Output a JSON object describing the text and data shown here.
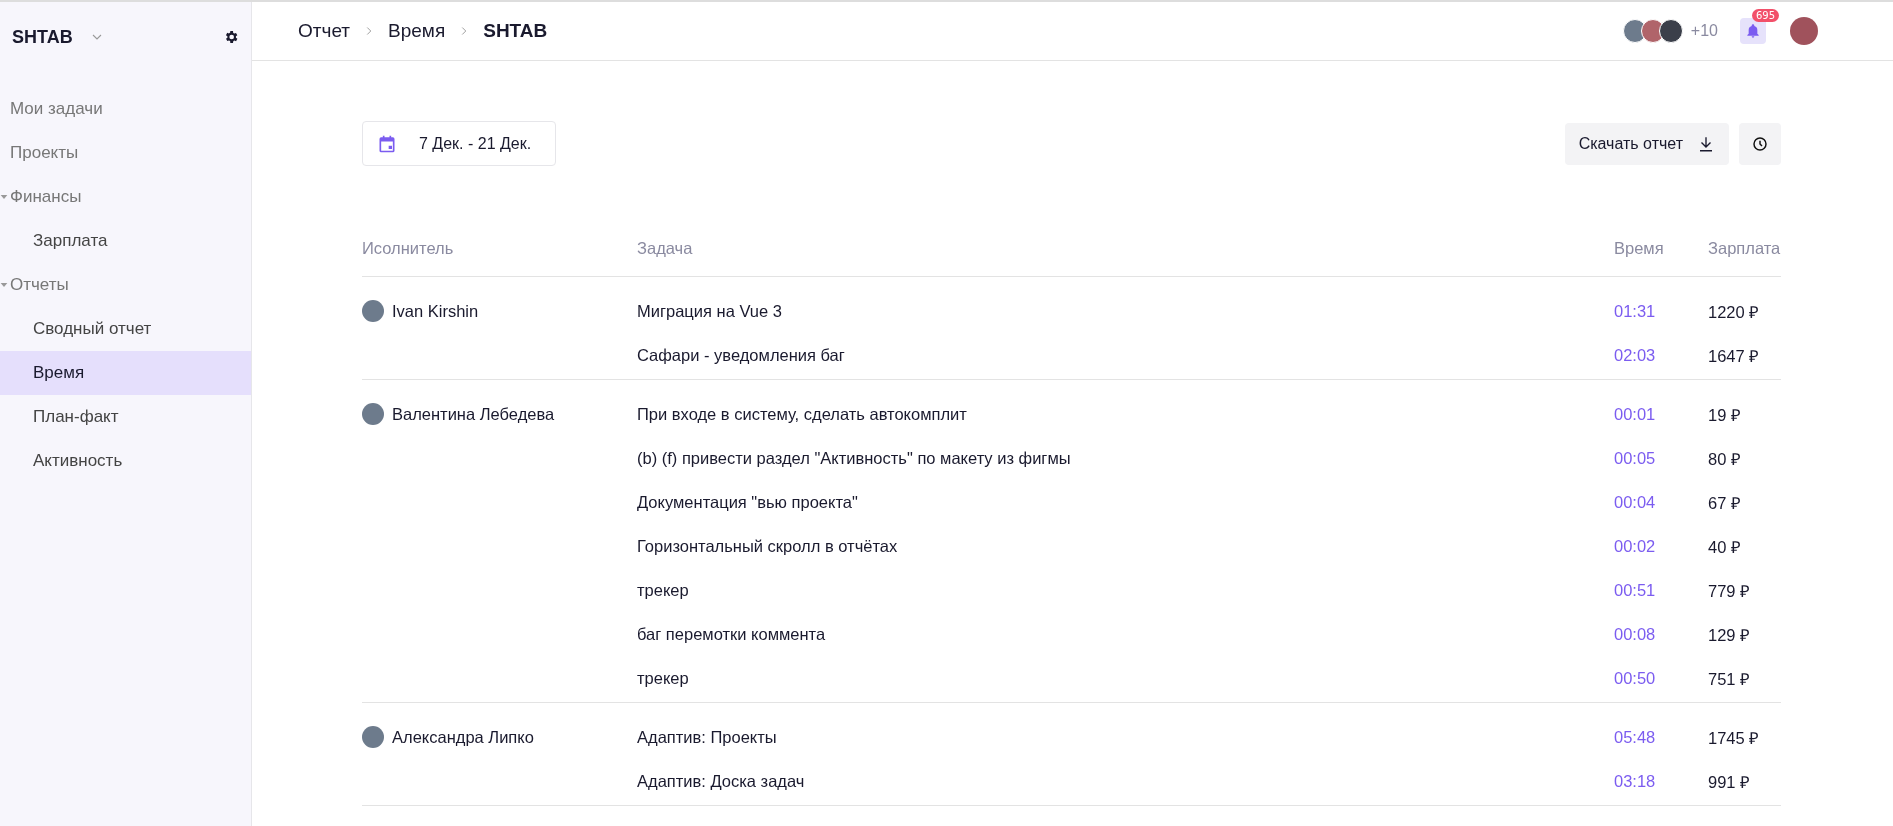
{
  "sidebar": {
    "workspace": "SHTAB",
    "items": [
      {
        "label": "Мои задачи",
        "selected": false
      },
      {
        "label": "Проекты",
        "selected": false
      },
      {
        "label": "Финансы",
        "selected": false,
        "expanded": true,
        "children": [
          {
            "label": "Зарплата",
            "selected": false
          }
        ]
      },
      {
        "label": "Отчеты",
        "selected": false,
        "expanded": true,
        "children": [
          {
            "label": "Сводный отчет",
            "selected": false
          },
          {
            "label": "Время",
            "selected": true
          },
          {
            "label": "План-факт",
            "selected": false
          },
          {
            "label": "Активность",
            "selected": false
          }
        ]
      }
    ]
  },
  "breadcrumbs": [
    "Отчет",
    "Время",
    "SHTAB"
  ],
  "header": {
    "more_members": "+10",
    "notifications": "695"
  },
  "date_range": "7 Дек. - 21 Дек.",
  "download_button": "Скачать отчет",
  "table": {
    "columns": [
      "Исолнитель",
      "Задача",
      "Время",
      "Зарплата"
    ],
    "groups": [
      {
        "executor": "Ivan Kirshin",
        "rows": [
          {
            "task": "Миграция на Vue 3",
            "time": "01:31",
            "salary": "1220 ₽"
          },
          {
            "task": "Сафари - уведомления баг",
            "time": "02:03",
            "salary": "1647 ₽"
          }
        ]
      },
      {
        "executor": "Валентина Лебедева",
        "rows": [
          {
            "task": "При входе в систему, сделать автокомплит",
            "time": "00:01",
            "salary": "19 ₽"
          },
          {
            "task": "(b) (f) привести раздел \"Активность\" по макету из фигмы",
            "time": "00:05",
            "salary": "80 ₽"
          },
          {
            "task": "Документация \"вью проекта\"",
            "time": "00:04",
            "salary": "67 ₽"
          },
          {
            "task": "Горизонтальный скролл в отчётах",
            "time": "00:02",
            "salary": "40 ₽"
          },
          {
            "task": "трекер",
            "time": "00:51",
            "salary": "779 ₽"
          },
          {
            "task": "баг перемотки коммента",
            "time": "00:08",
            "salary": "129 ₽"
          },
          {
            "task": "трекер",
            "time": "00:50",
            "salary": "751 ₽"
          }
        ]
      },
      {
        "executor": "Александра Липко",
        "rows": [
          {
            "task": "Адаптив: Проекты",
            "time": "05:48",
            "salary": "1745 ₽"
          },
          {
            "task": "Адаптив: Доска задач",
            "time": "03:18",
            "salary": "991 ₽"
          }
        ]
      }
    ]
  }
}
